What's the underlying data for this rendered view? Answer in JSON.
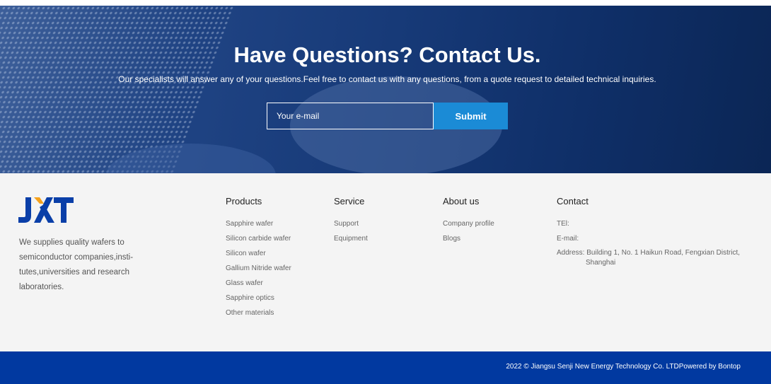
{
  "hero": {
    "title": "Have Questions? Contact Us.",
    "subtitle": "Our specialists will answer any of your questions.Feel free to contact us with any questions, from a quote request to detailed technical inquiries.",
    "email_placeholder": "Your e-mail",
    "submit_label": "Submit"
  },
  "brand": {
    "logo_text": "JXT",
    "logo_colors": {
      "main": "#0a3fa8",
      "accent": "#f5a11c"
    },
    "description": "We supplies quality wafers to semiconductor companies,insti-tutes,universities and research laboratories."
  },
  "columns": [
    {
      "title": "Products",
      "items": [
        "Sapphire wafer",
        "Silicon carbide wafer",
        "Silicon wafer",
        "Gallium Nitride wafer",
        "Glass wafer",
        "Sapphire optics",
        "Other materials"
      ]
    },
    {
      "title": "Service",
      "items": [
        "Support",
        "Equipment"
      ]
    },
    {
      "title": "About us",
      "items": [
        "Company profile",
        "Blogs"
      ]
    }
  ],
  "contact": {
    "title": "Contact",
    "tel": "TEl:",
    "email": "E-mail:",
    "address": "Address: Building 1, No. 1 Haikun Road, Fengxian District, Shanghai"
  },
  "copyright": "2022 © Jiangsu Senji New Energy Technology Co. LTDPowered by Bontop",
  "colors": {
    "submit": "#1b8bd6",
    "bottom_bar": "#0139a0"
  }
}
